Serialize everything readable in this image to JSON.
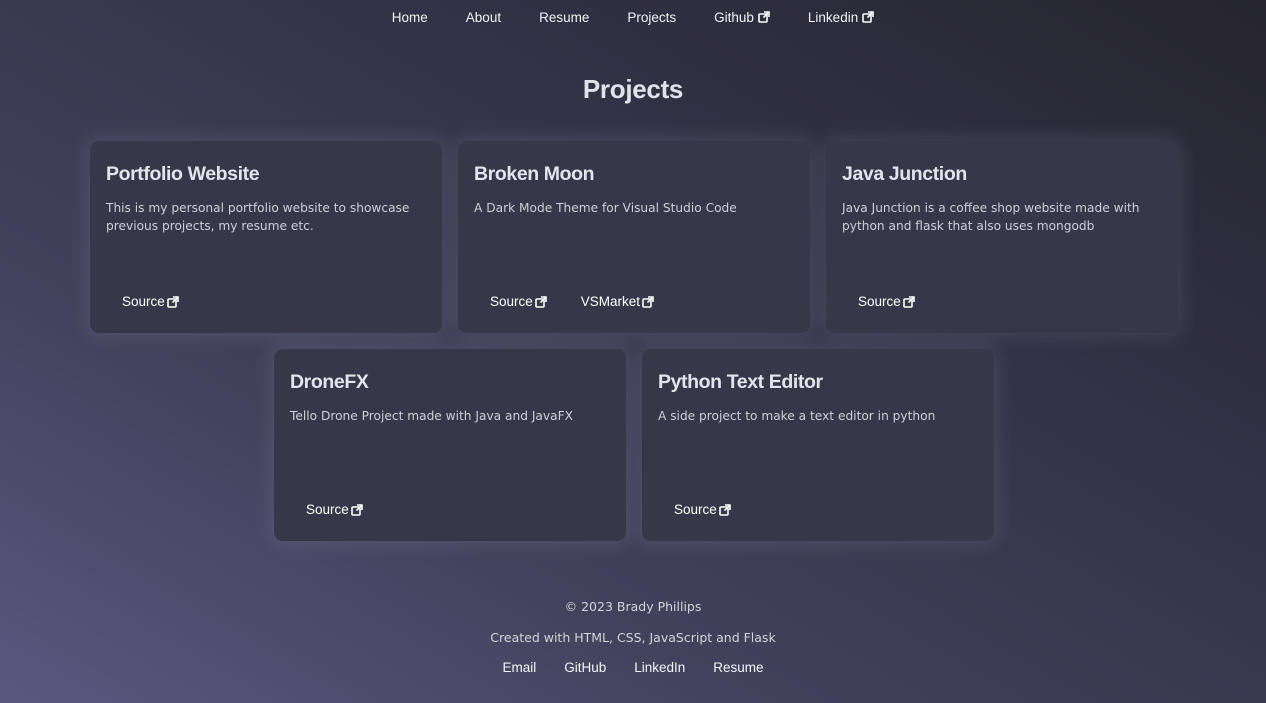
{
  "nav": {
    "items": [
      {
        "label": "Home",
        "external": false
      },
      {
        "label": "About",
        "external": false
      },
      {
        "label": "Resume",
        "external": false
      },
      {
        "label": "Projects",
        "external": false
      },
      {
        "label": "Github",
        "external": true
      },
      {
        "label": "Linkedin",
        "external": true
      }
    ]
  },
  "page": {
    "title": "Projects"
  },
  "projects": [
    {
      "title": "Portfolio Website",
      "description": "This is my personal portfolio website to showcase previous projects, my resume etc.",
      "links": [
        "Source"
      ]
    },
    {
      "title": "Broken Moon",
      "description": "A Dark Mode Theme for Visual Studio Code",
      "links": [
        "Source",
        "VSMarket"
      ]
    },
    {
      "title": "Java Junction",
      "description": "Java Junction is a coffee shop website made with python and flask that also uses mongodb",
      "links": [
        "Source"
      ]
    },
    {
      "title": "DroneFX",
      "description": "Tello Drone Project made with Java and JavaFX",
      "links": [
        "Source"
      ]
    },
    {
      "title": "Python Text Editor",
      "description": "A side project to make a text editor in python",
      "links": [
        "Source"
      ]
    }
  ],
  "footer": {
    "copyright": "© 2023 Brady Phillips",
    "credits": "Created with HTML, CSS, JavaScript and Flask",
    "links": [
      "Email",
      "GitHub",
      "LinkedIn",
      "Resume"
    ]
  },
  "icons": {
    "external_link": "external-link-icon"
  },
  "colors": {
    "card_bg": "#383749",
    "text": "#e8e8ef"
  }
}
